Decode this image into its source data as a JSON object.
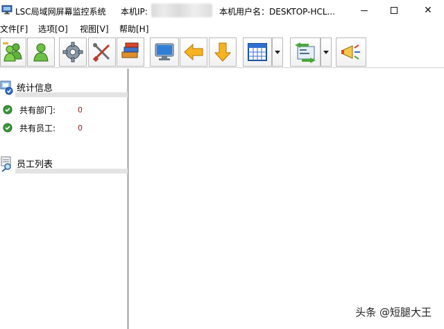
{
  "window": {
    "title": "LSC局域网屏幕监控系统",
    "ip_label": "本机IP:",
    "user_label": "本机用户名：DESKTOP-HCL..."
  },
  "window_controls": {
    "close_glyph": "✕"
  },
  "menu": {
    "items": [
      {
        "label": "文件[F]"
      },
      {
        "label": "选项[O]"
      },
      {
        "label": "视图[V]"
      },
      {
        "label": "帮助[H]"
      }
    ]
  },
  "toolbar": {
    "icons": [
      "users-add-icon",
      "user-icon",
      "gear-icon",
      "tools-icon",
      "books-icon",
      "monitor-icon",
      "arrow-left-icon",
      "arrow-down-icon",
      "calendar-icon",
      "transfer-icon",
      "megaphone-icon"
    ]
  },
  "left_panel": {
    "stats": {
      "title": "统计信息",
      "rows": [
        {
          "label": "共有部门:",
          "value": "0"
        },
        {
          "label": "共有员工:",
          "value": "0"
        }
      ]
    },
    "employees": {
      "title": "员工列表"
    }
  },
  "watermark": "头条 @短腿大王",
  "colors": {
    "value_red": "#8b1a1a",
    "divider": "#bdbdbd",
    "check_green": "#3a9a3a"
  }
}
